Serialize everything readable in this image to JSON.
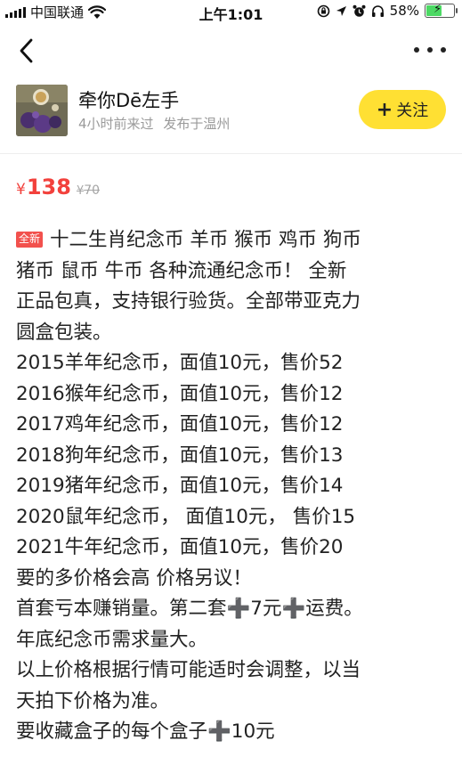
{
  "status_bar": {
    "carrier": "中国联通",
    "time": "上午1:01",
    "battery": "58%",
    "battery_level": 0.58
  },
  "nav": {
    "back_icon": "chevron-left-icon",
    "more_icon": "more-horizontal-icon"
  },
  "seller": {
    "name": "牵你Dē左手",
    "last_seen": "4小时前来过",
    "location": "发布于温州",
    "follow_label": "关注"
  },
  "price": {
    "currency": "¥",
    "current": "138",
    "original": "70"
  },
  "description": {
    "badge": "全新",
    "lines": [
      "十二生肖纪念币 羊币 猴币 鸡币 狗币",
      "猪币 鼠币 牛币 各种流通纪念币！ 全新",
      "正品包真，支持银行验货。全部带亚克力",
      "圆盒包装。",
      "2015羊年纪念币，面值10元，售价52",
      "2016猴年纪念币，面值10元，售价12",
      "2017鸡年纪念币，面值10元，售价12",
      "2018狗年纪念币，面值10元，售价13",
      "2019猪年纪念币，面值10元，售价14",
      "2020鼠年纪念币， 面值10元， 售价15",
      "2021牛年纪念币，面值10元，售价20",
      "要的多价格会高 价格另议！",
      "首套亏本赚销量。第二套➕7元➕运费。",
      "年底纪念币需求量大。",
      "以上价格根据行情可能适时会调整，以当",
      "天拍下价格为准。",
      "要收藏盒子的每个盒子➕10元"
    ]
  },
  "colors": {
    "price_red": "#f2413c",
    "follow_yellow": "#ffe033",
    "badge_red": "#f2514d",
    "battery_green": "#4cd964"
  }
}
